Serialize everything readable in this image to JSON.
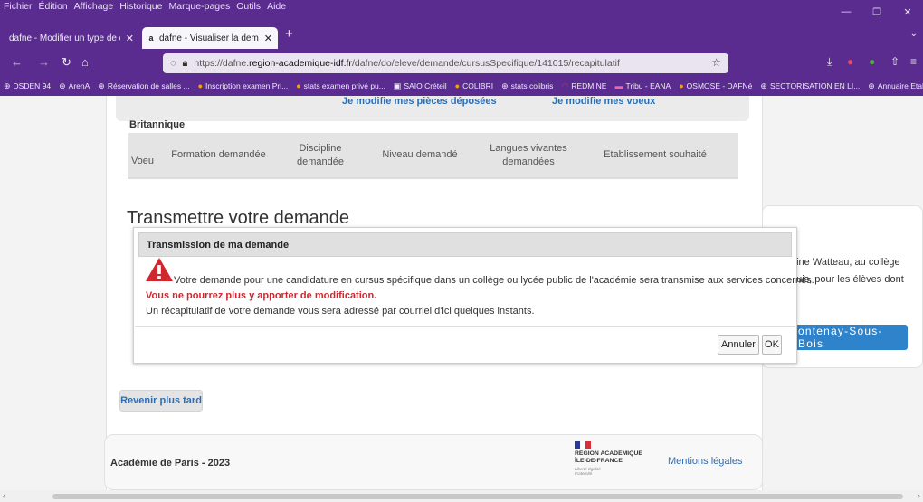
{
  "menubar": [
    "Fichier",
    "Édition",
    "Affichage",
    "Historique",
    "Marque-pages",
    "Outils",
    "Aide"
  ],
  "tabs": [
    {
      "title": "dafne - Modifier un type de deman"
    },
    {
      "title": "dafne - Visualiser la demande -"
    }
  ],
  "url": {
    "prefix": "https://dafne.",
    "host": "region-academique-idf.fr",
    "path": "/dafne/do/eleve/demande/cursusSpecifique/141015/recapitulatif"
  },
  "bookmarks": [
    "DSDEN 94",
    "ArenA",
    "Réservation de salles ...",
    "Inscription examen Pri...",
    "stats examen privé pu...",
    "SAIO Créteil",
    "COLIBRI",
    "stats colibris",
    "REDMINE",
    "Tribu - EANA",
    "OSMOSE - DAFNé",
    "SECTORISATION EN LI...",
    "Annuaire Etab"
  ],
  "page": {
    "top_label": "Britannique",
    "ghost_buttons": [
      "Je modifie mes pièces déposées",
      "Je modifie mes voeux"
    ],
    "table_headers": [
      "Voeu",
      "Formation demandée",
      "Discipline demandée",
      "Niveau demandé",
      "Langues vivantes demandées",
      "Etablissement souhaité"
    ],
    "section_title": "Transmettre votre demande",
    "side_text": "oine Watteau, au collège puis, pour les élèves dont",
    "side_button": "ontenay-Sous-Bois",
    "later_button": "Revenir plus tard",
    "footer": {
      "academy": "Académie de Paris - 2023",
      "logo_line1": "RÉGION ACADÉMIQUE",
      "logo_line2": "ÎLE-DE-FRANCE",
      "logo_motto": "Liberté Égalité Fraternité",
      "legal": "Mentions légales"
    }
  },
  "modal": {
    "title": "Transmission de ma demande",
    "message": "Votre demande pour une candidature en cursus spécifique dans un collège ou lycée public de l'académie sera transmise aux services concernés.",
    "warning": "Vous ne pourrez plus y apporter de modification.",
    "info": "Un récapitulatif de votre demande vous sera adressé par courriel d'ici quelques instants.",
    "cancel_label": "Annuler",
    "ok_label": "OK"
  },
  "colors": {
    "browser_chrome": "#5b2c8f",
    "link_blue": "#2e6db0",
    "button_blue": "#2f83cb",
    "warning_red": "#d0272f"
  }
}
